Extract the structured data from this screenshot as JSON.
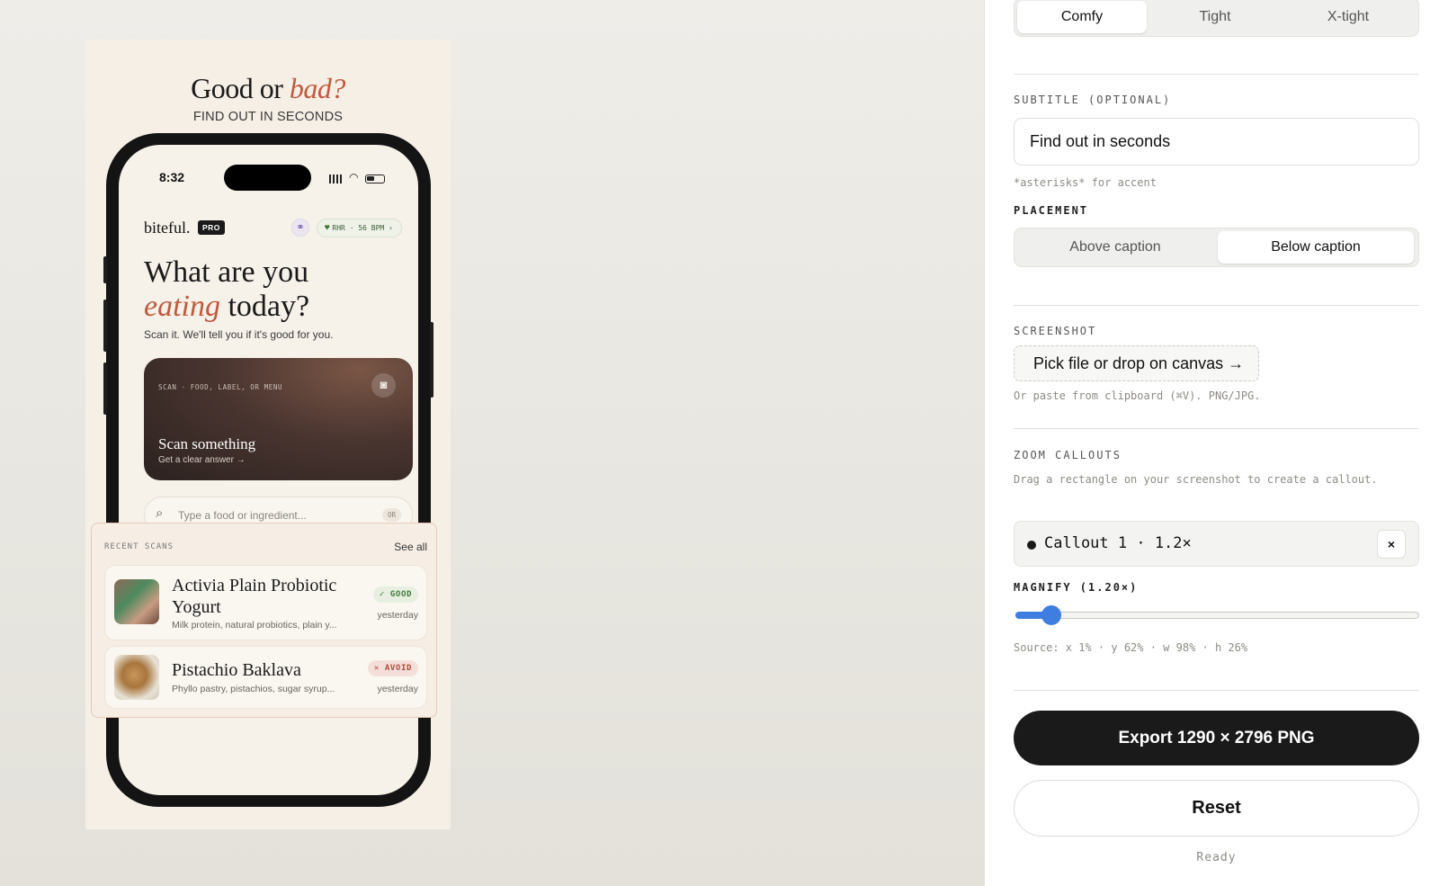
{
  "poster": {
    "title_lead": "Good or ",
    "title_accent": "bad?",
    "subtitle": "FIND OUT IN SECONDS"
  },
  "phone": {
    "time": "8:32",
    "brand": "biteful.",
    "pro_badge": "PRO",
    "link_icon": "link-icon",
    "rhr_chip": "RHR · 56 BPM ›",
    "headline_line1": "What are you",
    "headline_accent": "eating",
    "headline_rest": " today?",
    "tagline": "Scan it. We'll tell you if it's good for you.",
    "scan_card": {
      "label": "SCAN · FOOD, LABEL, OR MENU",
      "title": "Scan something",
      "subtitle": "Get a clear answer →"
    },
    "search": {
      "placeholder": "Type a food or ingredient...",
      "or_badge": "OR"
    }
  },
  "recent": {
    "label": "RECENT SCANS",
    "see_all": "See all",
    "items": [
      {
        "name": "Activia Plain Probiotic Yogurt",
        "desc": "Milk protein, natural probiotics, plain y...",
        "badge": "✓ GOOD",
        "when": "yesterday",
        "verdict": "good"
      },
      {
        "name": "Pistachio Baklava",
        "desc": "Phyllo pastry, pistachios, sugar syrup...",
        "badge": "✕ AVOID",
        "when": "yesterday",
        "verdict": "avoid"
      }
    ]
  },
  "panel": {
    "density": {
      "options": [
        "Comfy",
        "Tight",
        "X-tight"
      ],
      "selected": "Comfy"
    },
    "subtitle_label": "SUBTITLE (OPTIONAL)",
    "subtitle_value": "Find out in seconds",
    "subtitle_hint": "*asterisks* for accent",
    "placement_label": "PLACEMENT",
    "placement": {
      "options": [
        "Above caption",
        "Below caption"
      ],
      "selected": "Below caption"
    },
    "screenshot_label": "SCREENSHOT",
    "pick_button": "Pick file or drop on canvas →",
    "screenshot_hint": "Or paste from clipboard (⌘V). PNG/JPG.",
    "zoom_label": "ZOOM CALLOUTS",
    "zoom_hint": "Drag a rectangle on your screenshot to create a callout.",
    "callout": "Callout 1 · 1.2×",
    "callout_close": "×",
    "magnify_label": "MAGNIFY (1.20×)",
    "magnify_fraction": 0.09,
    "source_text": "Source: x 1% · y 62% · w 98% · h 26%",
    "export_button": "Export 1290 × 2796 PNG",
    "reset_button": "Reset",
    "status": "Ready"
  },
  "colors": {
    "accent": "#c05a3f",
    "slider": "#3f7ee0",
    "good": "#3e7a3a",
    "avoid": "#b5483a"
  }
}
